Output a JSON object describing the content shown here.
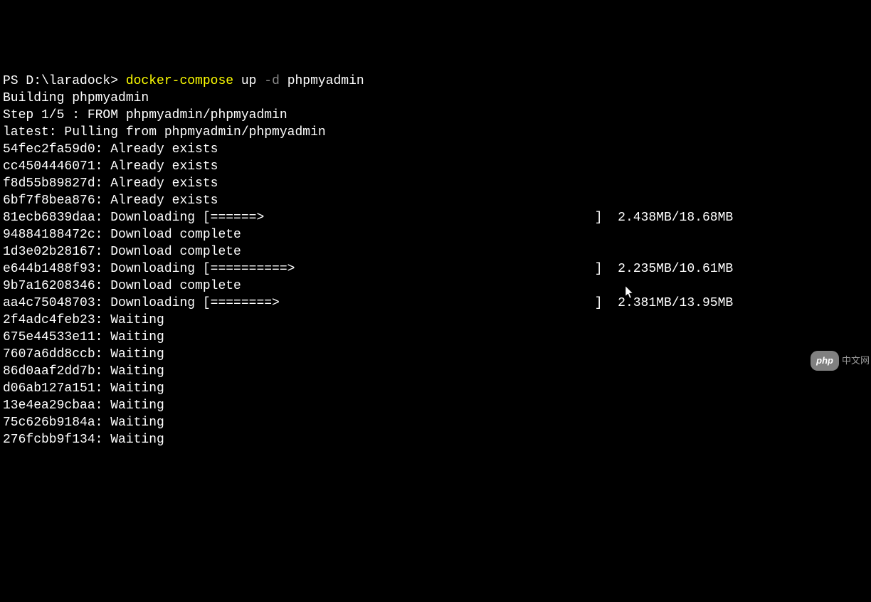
{
  "prompt": {
    "prefix": "PS ",
    "path": "D:\\laradock",
    "caret": "> ",
    "cmd": "docker-compose",
    "sub": " up ",
    "flag": "-d",
    "arg": " phpmyadmin"
  },
  "build": {
    "line1": "Building phpmyadmin",
    "line2": "Step 1/5 : FROM phpmyadmin/phpmyadmin",
    "line3": "latest: Pulling from phpmyadmin/phpmyadmin"
  },
  "layers": [
    {
      "id": "54fec2fa59d0",
      "status": "Already exists"
    },
    {
      "id": "cc4504446071",
      "status": "Already exists"
    },
    {
      "id": "f8d55b89827d",
      "status": "Already exists"
    },
    {
      "id": "6bf7f8bea876",
      "status": "Already exists"
    },
    {
      "id": "81ecb6839daa",
      "status": "Downloading",
      "bar": "[======>                                           ]",
      "size": "2.438MB/18.68MB"
    },
    {
      "id": "94884188472c",
      "status": "Download complete"
    },
    {
      "id": "1d3e02b28167",
      "status": "Download complete"
    },
    {
      "id": "e644b1488f93",
      "status": "Downloading",
      "bar": "[==========>                                       ]",
      "size": "2.235MB/10.61MB"
    },
    {
      "id": "9b7a16208346",
      "status": "Download complete"
    },
    {
      "id": "aa4c75048703",
      "status": "Downloading",
      "bar": "[========>                                         ]",
      "size": "2.381MB/13.95MB"
    },
    {
      "id": "2f4adc4feb23",
      "status": "Waiting"
    },
    {
      "id": "675e44533e11",
      "status": "Waiting"
    },
    {
      "id": "7607a6dd8ccb",
      "status": "Waiting"
    },
    {
      "id": "86d0aaf2dd7b",
      "status": "Waiting"
    },
    {
      "id": "d06ab127a151",
      "status": "Waiting"
    },
    {
      "id": "13e4ea29cbaa",
      "status": "Waiting"
    },
    {
      "id": "75c626b9184a",
      "status": "Waiting"
    },
    {
      "id": "276fcbb9f134",
      "status": "Waiting"
    }
  ],
  "watermark": {
    "badge": "php",
    "text": "中文网"
  }
}
